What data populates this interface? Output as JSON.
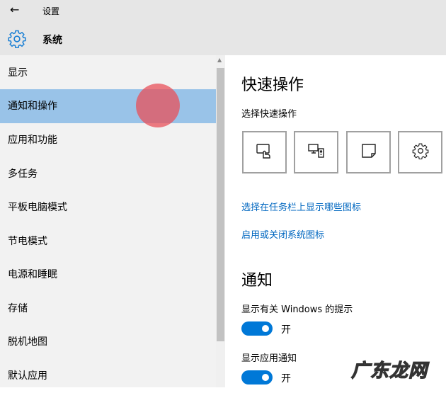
{
  "header": {
    "back_icon": "arrow-left-icon",
    "app_title": "设置",
    "section_icon": "gear-icon",
    "section_title": "系统"
  },
  "sidebar": {
    "selected": 1,
    "items": [
      {
        "label": "显示"
      },
      {
        "label": "通知和操作"
      },
      {
        "label": "应用和功能"
      },
      {
        "label": "多任务"
      },
      {
        "label": "平板电脑模式"
      },
      {
        "label": "节电模式"
      },
      {
        "label": "电源和睡眠"
      },
      {
        "label": "存储"
      },
      {
        "label": "脱机地图"
      },
      {
        "label": "默认应用"
      }
    ]
  },
  "main": {
    "quick_title": "快速操作",
    "quick_subtitle": "选择快速操作",
    "tiles": [
      {
        "icon": "tablet-mode-icon"
      },
      {
        "icon": "project-icon"
      },
      {
        "icon": "note-icon"
      },
      {
        "icon": "settings-gear-icon"
      }
    ],
    "link1": "选择在任务栏上显示哪些图标",
    "link2": "启用或关闭系统图标",
    "notify_title": "通知",
    "toggle1": {
      "label": "显示有关 Windows 的提示",
      "state": "开"
    },
    "toggle2": {
      "label": "显示应用通知",
      "state": "开"
    }
  },
  "colors": {
    "accent": "#0078d7",
    "selected": "#99c3e8",
    "link": "#0067c0"
  },
  "watermark": "广东龙网"
}
